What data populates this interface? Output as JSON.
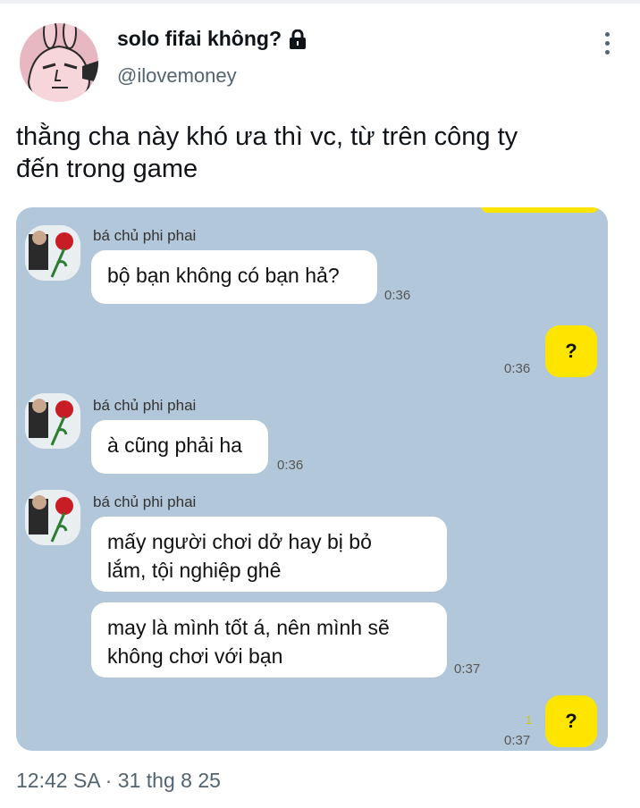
{
  "author": {
    "display_name": "solo fifai không?",
    "lock_icon": "lock-icon",
    "handle": "@ilovemoney"
  },
  "tweet": {
    "text_line1": "thằng cha này khó ưa thì vc, từ trên công ty",
    "text_line2": "đến trong game",
    "timestamp": "12:42 SA · 31 thg 8 25"
  },
  "chat": {
    "background": "#b2c7d9",
    "my_bubble_color": "#fee500",
    "messages": [
      {
        "sender": "bá chủ phi phai",
        "lines": [
          "bộ bạn không có bạn hả?"
        ],
        "time": "0:36"
      },
      {
        "mine": true,
        "text": "?",
        "time": "0:36"
      },
      {
        "sender": "bá chủ phi phai",
        "lines": [
          "à cũng phải ha"
        ],
        "time": "0:36"
      },
      {
        "sender": "bá chủ phi phai",
        "lines": [
          "mấy người chơi dở hay bị bỏ",
          "lắm, tội nghiệp ghê"
        ]
      },
      {
        "lines": [
          "may là mình tốt á, nên mình sẽ",
          "không chơi với bạn"
        ],
        "time": "0:37"
      },
      {
        "mine": true,
        "text": "?",
        "time": "0:37",
        "unread": "1"
      }
    ]
  }
}
